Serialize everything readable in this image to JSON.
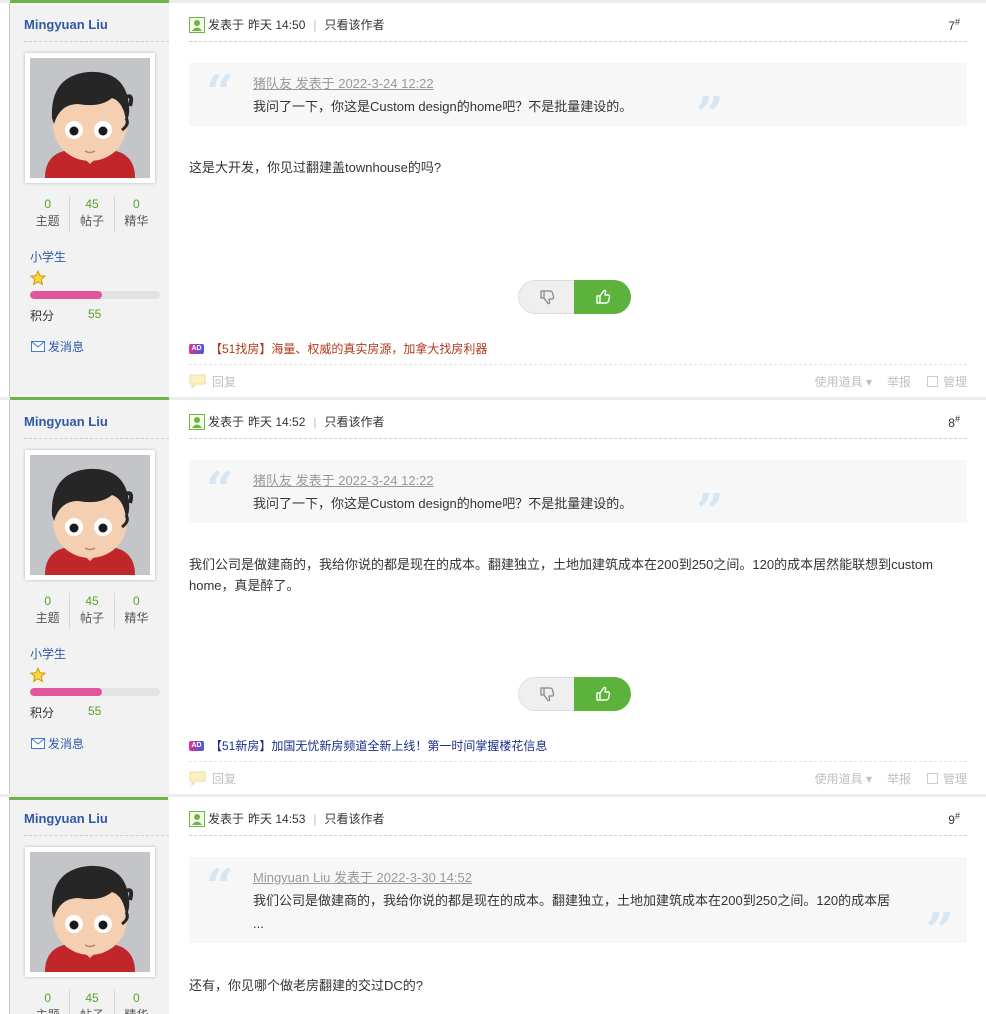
{
  "labels": {
    "stat_threads": "主题",
    "stat_posts": "帖子",
    "stat_digest": "精华",
    "points_label": "积分",
    "send_message": "发消息",
    "posted_prefix": "发表于",
    "only_author": "只看该作者",
    "reply": "回复",
    "use_tools": "使用道具",
    "report": "举报",
    "manage": "管理"
  },
  "posts": [
    {
      "author": "Mingyuan Liu",
      "stats": {
        "threads": "0",
        "posts": "45",
        "digest": "0"
      },
      "rank": "小学生",
      "points": "55",
      "points_progress": 0.55,
      "time": "昨天 14:50",
      "floor": "7",
      "quote_meta": "猪队友 发表于 2022-3-24 12:22",
      "quote_text": "我问了一下，你这是Custom design的home吧？不是批量建设的。",
      "body": "这是大开发，你见过翻建盖townhouse的吗?",
      "ad_text": "【51找房】海量、权威的真实房源，加拿大找房利器",
      "ad_color": "#b03a1c"
    },
    {
      "author": "Mingyuan Liu",
      "stats": {
        "threads": "0",
        "posts": "45",
        "digest": "0"
      },
      "rank": "小学生",
      "points": "55",
      "points_progress": 0.55,
      "time": "昨天 14:52",
      "floor": "8",
      "quote_meta": "猪队友 发表于 2022-3-24 12:22",
      "quote_text": "我问了一下，你这是Custom design的home吧？不是批量建设的。",
      "body": "我们公司是做建商的，我给你说的都是现在的成本。翻建独立，土地加建筑成本在200到250之间。120的成本居然能联想到custom home，真是醉了。",
      "ad_text": "【51新房】加国无忧新房频道全新上线！第一时间掌握楼花信息",
      "ad_color": "#1c2f8a"
    },
    {
      "author": "Mingyuan Liu",
      "stats": {
        "threads": "0",
        "posts": "45",
        "digest": "0"
      },
      "time": "昨天 14:53",
      "floor": "9",
      "quote_meta": "Mingyuan Liu 发表于 2022-3-30 14:52",
      "quote_text": "我们公司是做建商的，我给你说的都是现在的成本。翻建独立，土地加建筑成本在200到250之间。120的成本居 ...",
      "body": "还有，你见哪个做老房翻建的交过DC的?"
    }
  ],
  "colors": {
    "accent_green": "#6db544",
    "like_green": "#5cb23b",
    "link_blue": "#3058a8",
    "points_bar": "#e0579d"
  },
  "icons": {
    "post": "user-post-icon",
    "star": "star-icon",
    "mail": "envelope-icon",
    "thumbs_down": "thumbs-down-icon",
    "thumbs_up": "thumbs-up-icon",
    "reply": "reply-bubble-icon",
    "ad": "ad-badge-icon"
  }
}
